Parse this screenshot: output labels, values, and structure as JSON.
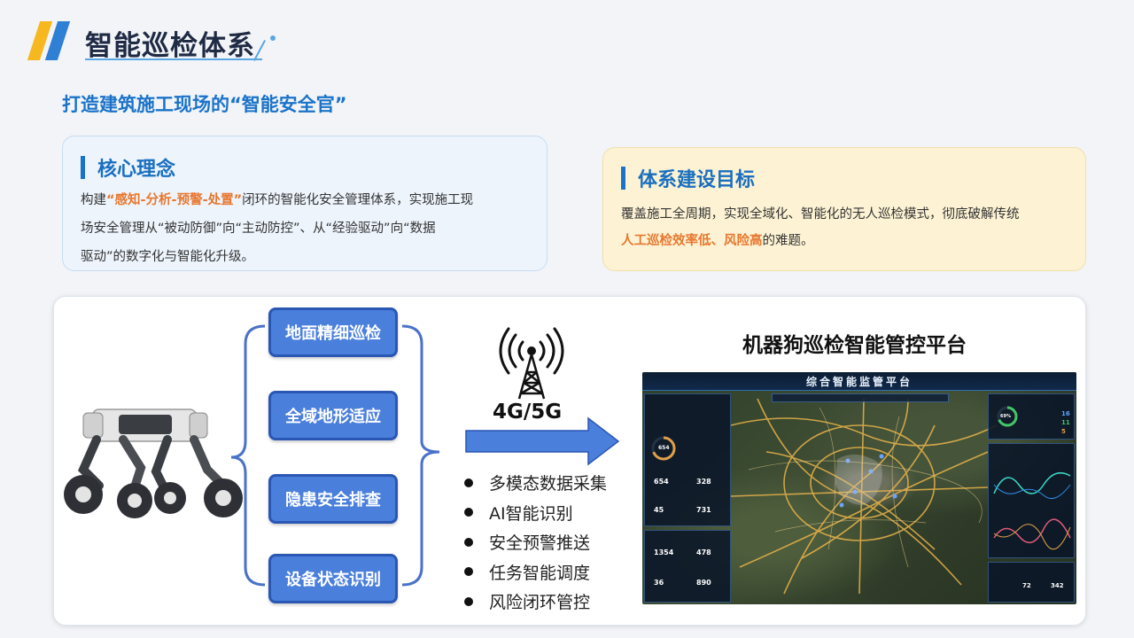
{
  "header": {
    "title": "智能巡检体系"
  },
  "subtitle": "打造建筑施工现场的“智能安全官”",
  "core_card": {
    "title": "核心理念",
    "line1_pre": "构建",
    "line1_highlight": "“感知-分析-预警-处置”",
    "line1_post": "闭环的智能化安全管理体系，实现施工现",
    "line2": "场安全管理从“被动防御”向“主动防控”、从“经验驱动”向“数据",
    "line3": "驱动”的数字化与智能化升级。"
  },
  "goal_card": {
    "title": "体系建设目标",
    "line1": "覆盖施工全周期，实现全域化、智能化的无人巡检模式，彻底破解传统",
    "line2_highlight": "人工巡检效率低、风险高",
    "line2_post": "的难题。"
  },
  "functions": [
    "地面精细巡检",
    "全域地形适应",
    "隐患安全排查",
    "设备状态识别"
  ],
  "signal_label": "4G/5G",
  "features": [
    "多模态数据采集",
    "AI智能识别",
    "安全预警推送",
    "任务智能调度",
    "风险闭环管控"
  ],
  "platform": {
    "title": "机器狗巡检智能管控平台",
    "dashboard_title": "综合智能监管平台",
    "gauge_value": "654",
    "gauge_pct": "69%",
    "left_stats": [
      "654",
      "328",
      "45",
      "731",
      "1354",
      "478",
      "36",
      "890"
    ],
    "right_stats": [
      "16",
      "11",
      "5",
      "72",
      "342"
    ]
  },
  "colors": {
    "accent_blue": "#1a73c9",
    "highlight_orange": "#e8772e",
    "button_blue": "#4a7fdc"
  }
}
